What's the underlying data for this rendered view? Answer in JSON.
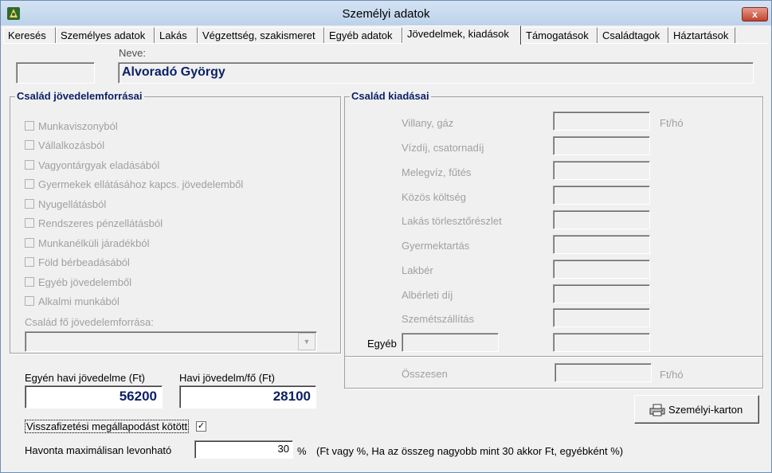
{
  "window": {
    "title": "Személyi adatok",
    "close_label": "x"
  },
  "tabs": [
    {
      "label": "Keresés"
    },
    {
      "label": "Személyes adatok"
    },
    {
      "label": "Lakás"
    },
    {
      "label": "Végzettség, szakismeret"
    },
    {
      "label": "Egyéb adatok"
    },
    {
      "label": "Jövedelmek, kiadások"
    },
    {
      "label": "Támogatások"
    },
    {
      "label": "Családtagok"
    },
    {
      "label": "Háztartások"
    }
  ],
  "active_tab": "Jövedelmek, kiadások",
  "person": {
    "name_label": "Neve:",
    "name": "Alvoradó György",
    "id_value": ""
  },
  "income": {
    "title": "Család jövedelemforrásai",
    "sources": [
      {
        "label": "Munkaviszonyból",
        "checked": false
      },
      {
        "label": "Vállalkozásból",
        "checked": false
      },
      {
        "label": "Vagyontárgyak eladásából",
        "checked": false
      },
      {
        "label": "Gyermekek ellátásához kapcs. jövedelemből",
        "checked": false
      },
      {
        "label": "Nyugellátásból",
        "checked": false
      },
      {
        "label": "Rendszeres pénzellátásból",
        "checked": false
      },
      {
        "label": "Munkanélküli járadékból",
        "checked": false
      },
      {
        "label": "Föld bérbeadásából",
        "checked": false
      },
      {
        "label": "Egyéb jövedelemből",
        "checked": false
      },
      {
        "label": "Alkalmi munkából",
        "checked": false
      }
    ],
    "main_source_label": "Család fő jövedelemforrása:",
    "main_source_value": ""
  },
  "expenses": {
    "title": "Család kiadásai",
    "unit": "Ft/hó",
    "items": [
      {
        "label": "Villany, gáz",
        "value": ""
      },
      {
        "label": "Vízdíj, csatornadíj",
        "value": ""
      },
      {
        "label": "Melegvíz, fűtés",
        "value": ""
      },
      {
        "label": "Közös költség",
        "value": ""
      },
      {
        "label": "Lakás törlesztőrészlet",
        "value": ""
      },
      {
        "label": "Gyermektartás",
        "value": ""
      },
      {
        "label": "Lakbér",
        "value": ""
      },
      {
        "label": "Albérleti díj",
        "value": ""
      },
      {
        "label": "Szemétszállítás",
        "value": ""
      }
    ],
    "other_label": "Egyéb",
    "other_name": "",
    "other_value": "",
    "total_label": "Összesen",
    "total_value": ""
  },
  "summary": {
    "individual_label": "Egyén havi jövedelme (Ft)",
    "individual_value": "56200",
    "per_capita_label": "Havi jövedelm/fő (Ft)",
    "per_capita_value": "28100"
  },
  "repayment": {
    "agreement_label": "Visszafizetési megállapodást kötött",
    "agreement_checked": true,
    "max_label": "Havonta maximálisan levonható",
    "max_value": "30",
    "max_unit": "%",
    "note": "(Ft vagy %, Ha az összeg nagyobb mint 30 akkor Ft, egyébként %)"
  },
  "buttons": {
    "card_label": "Személyi-karton"
  },
  "colors": {
    "accent": "#0a1f66",
    "disabled_text": "#a0a0a0",
    "panel_bg": "#f0f0f0"
  }
}
